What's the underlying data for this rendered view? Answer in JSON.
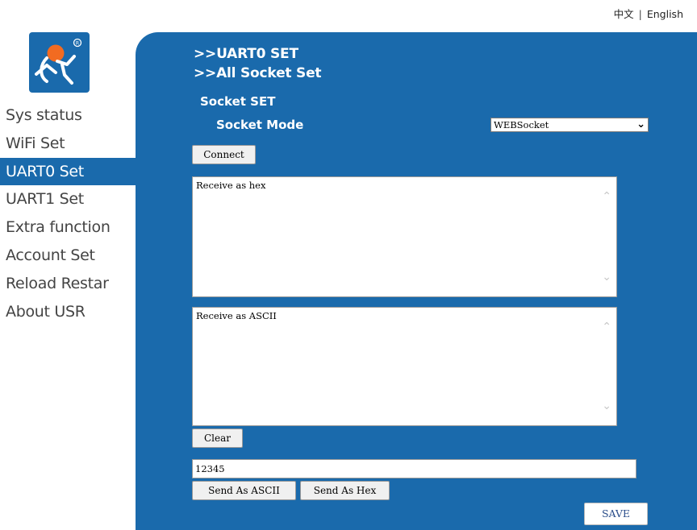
{
  "lang": {
    "zh": "中文",
    "sep": "|",
    "en": "English"
  },
  "logo": {
    "icon": "usr-person-logo-icon"
  },
  "nav": {
    "items": [
      {
        "label": "Sys status"
      },
      {
        "label": "WiFi Set"
      },
      {
        "label": "UART0 Set",
        "active": true
      },
      {
        "label": "UART1 Set"
      },
      {
        "label": "Extra function"
      },
      {
        "label": "Account Set"
      },
      {
        "label": "Reload Restar"
      },
      {
        "label": "About USR"
      }
    ]
  },
  "breadcrumb": {
    "uart0": ">>UART0 SET",
    "all_socket": ">>All Socket Set"
  },
  "socket": {
    "section_title": "Socket SET",
    "mode_label": "Socket Mode",
    "mode_value": "WEBSocket"
  },
  "buttons": {
    "connect": "Connect",
    "clear": "Clear",
    "send_ascii": "Send As ASCII",
    "send_hex": "Send As Hex",
    "save": "SAVE"
  },
  "receive": {
    "hex_text": "Receive as hex",
    "ascii_text": "Receive as ASCII"
  },
  "send": {
    "value": "12345"
  },
  "colors": {
    "primary": "#1a6aac",
    "logo_orange": "#f26b21"
  }
}
